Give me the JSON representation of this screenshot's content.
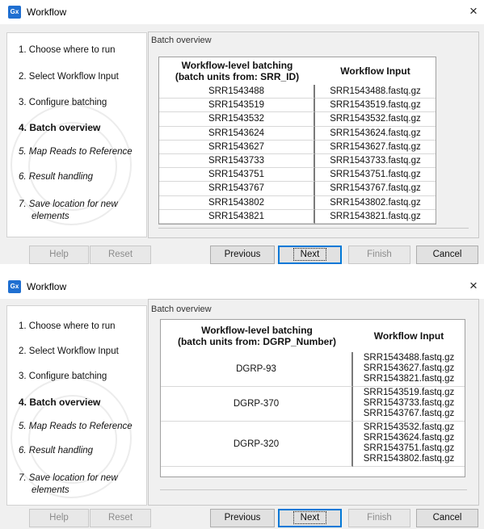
{
  "window": {
    "title": "Workflow",
    "app_icon": "Gx",
    "close": "×"
  },
  "steps": [
    {
      "label": "1.  Choose where to run",
      "state": "normal"
    },
    {
      "label": "2.  Select Workflow Input",
      "state": "normal"
    },
    {
      "label": "3.  Configure batching",
      "state": "normal"
    },
    {
      "label": "4.  Batch overview",
      "state": "active"
    },
    {
      "label": "5.  Map Reads to Reference",
      "state": "italic"
    },
    {
      "label": "6.  Result handling",
      "state": "italic"
    },
    {
      "label": "7.  Save location for new elements",
      "state": "italic"
    }
  ],
  "panel_label": "Batch overview",
  "dialog1": {
    "col1_header": "Workflow-level batching (batch units from: SRR_ID)",
    "col1_line1": "Workflow-level batching",
    "col1_line2": "(batch units from: SRR_ID)",
    "col2_header": "Workflow Input",
    "rows": [
      {
        "id": "SRR1543488",
        "input": "SRR1543488.fastq.gz"
      },
      {
        "id": "SRR1543519",
        "input": "SRR1543519.fastq.gz"
      },
      {
        "id": "SRR1543532",
        "input": "SRR1543532.fastq.gz"
      },
      {
        "id": "SRR1543624",
        "input": "SRR1543624.fastq.gz"
      },
      {
        "id": "SRR1543627",
        "input": "SRR1543627.fastq.gz"
      },
      {
        "id": "SRR1543733",
        "input": "SRR1543733.fastq.gz"
      },
      {
        "id": "SRR1543751",
        "input": "SRR1543751.fastq.gz"
      },
      {
        "id": "SRR1543767",
        "input": "SRR1543767.fastq.gz"
      },
      {
        "id": "SRR1543802",
        "input": "SRR1543802.fastq.gz"
      },
      {
        "id": "SRR1543821",
        "input": "SRR1543821.fastq.gz"
      }
    ]
  },
  "dialog2": {
    "col1_line1": "Workflow-level batching",
    "col1_line2": "(batch units from: DGRP_Number)",
    "col2_header": "Workflow Input",
    "groups": [
      {
        "id": "DGRP-93",
        "inputs": [
          "SRR1543488.fastq.gz",
          "SRR1543627.fastq.gz",
          "SRR1543821.fastq.gz"
        ]
      },
      {
        "id": "DGRP-370",
        "inputs": [
          "SRR1543519.fastq.gz",
          "SRR1543733.fastq.gz",
          "SRR1543767.fastq.gz"
        ]
      },
      {
        "id": "DGRP-320",
        "inputs": [
          "SRR1543532.fastq.gz",
          "SRR1543624.fastq.gz",
          "SRR1543751.fastq.gz",
          "SRR1543802.fastq.gz"
        ]
      }
    ]
  },
  "buttons": {
    "help": "Help",
    "reset": "Reset",
    "previous": "Previous",
    "next": "Next",
    "finish": "Finish",
    "cancel": "Cancel"
  },
  "colors": {
    "accent": "#0078d7",
    "app_icon": "#1f6fd1"
  }
}
